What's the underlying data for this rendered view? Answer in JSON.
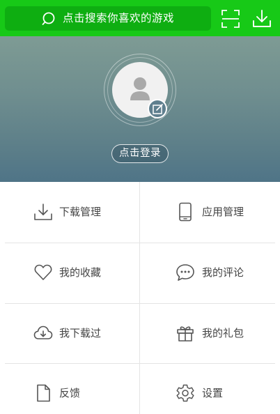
{
  "top_bar": {
    "search_placeholder": "点击搜索你喜欢的游戏",
    "accent_color": "#17c917",
    "icons": [
      "search-icon",
      "scan-icon",
      "download-icon"
    ]
  },
  "profile": {
    "login_label": "点击登录",
    "icons": [
      "avatar-icon",
      "edit-icon"
    ]
  },
  "menu": [
    {
      "label": "下载管理",
      "icon": "download-icon"
    },
    {
      "label": "应用管理",
      "icon": "phone-icon"
    },
    {
      "label": "我的收藏",
      "icon": "heart-icon"
    },
    {
      "label": "我的评论",
      "icon": "comment-icon"
    },
    {
      "label": "我下载过",
      "icon": "cloud-download-icon"
    },
    {
      "label": "我的礼包",
      "icon": "gift-icon"
    },
    {
      "label": "反馈",
      "icon": "file-icon"
    },
    {
      "label": "设置",
      "icon": "gear-icon"
    }
  ]
}
